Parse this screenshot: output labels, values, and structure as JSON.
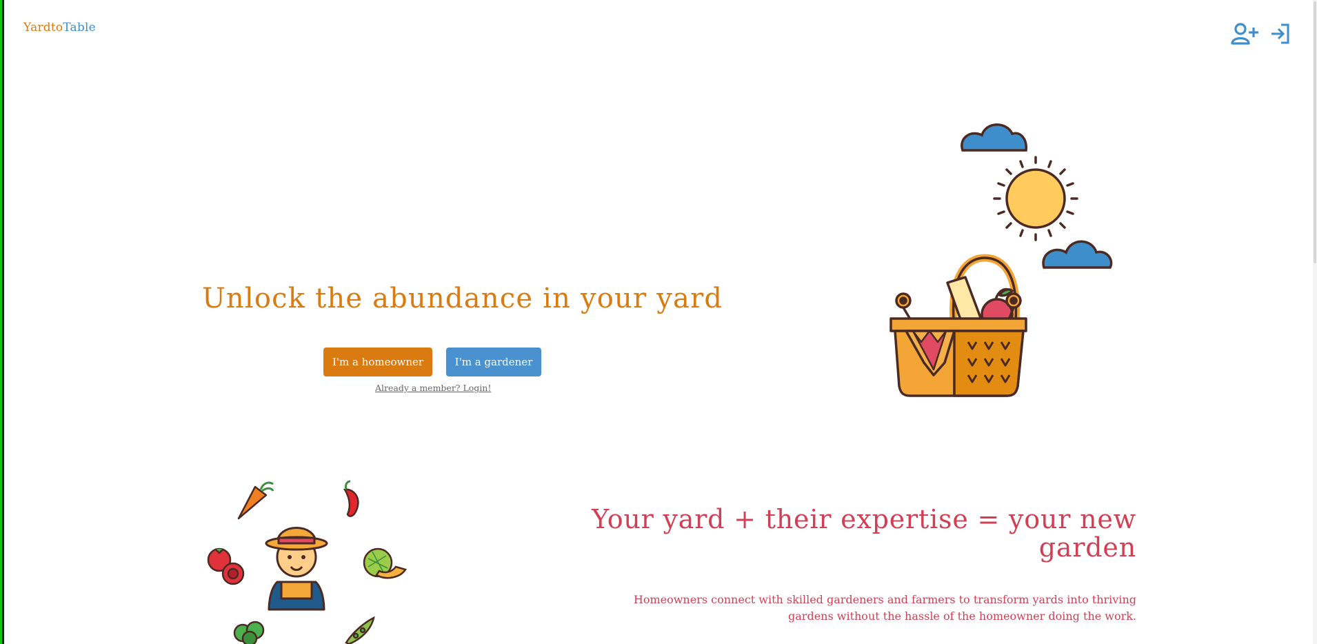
{
  "logo": {
    "part1": "Yard",
    "part2": "to",
    "part3": "Table"
  },
  "nav": {
    "register_icon": "add-user-icon",
    "login_icon": "login-icon"
  },
  "hero": {
    "title": "Unlock the abundance in your yard",
    "homeowner_button": "I'm a homeowner",
    "gardener_button": "I'm a gardener",
    "login_link": "Already a member? Login!"
  },
  "section2": {
    "title": "Your yard + their expertise = your new garden",
    "text": "Homeowners connect with skilled gardeners and farmers to transform yards into thriving gardens without the hassle of the homeowner doing the work."
  },
  "colors": {
    "orange": "#d97b10",
    "blue": "#3d8ecb",
    "red": "#d23f55"
  }
}
